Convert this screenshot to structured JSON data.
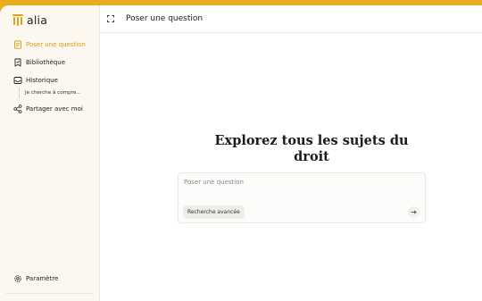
{
  "brand": {
    "name": "alia",
    "accent": "#e0a21c"
  },
  "sidebar": {
    "items": [
      {
        "label": "Poser une question",
        "icon": "document-list-icon",
        "active": true
      },
      {
        "label": "Bibliothèque",
        "icon": "bookmark-check-icon",
        "active": false
      },
      {
        "label": "Historique",
        "icon": "inbox-icon",
        "active": false
      },
      {
        "label": "Partager avec moi",
        "icon": "share-icon",
        "active": false
      }
    ],
    "history": [
      "Je cherche à compre..."
    ],
    "settings_label": "Paramètre",
    "settings_icon": "gear-icon"
  },
  "topbar": {
    "title": "Poser une question",
    "expand_icon": "expand-icon"
  },
  "main": {
    "headline_line1": "Explorez tous les sujets du",
    "headline_line2": "droit",
    "prompt": {
      "placeholder": "Poser une question",
      "value": "",
      "advanced_label": "Recherche avancée",
      "send_icon": "arrow-right-icon"
    }
  }
}
